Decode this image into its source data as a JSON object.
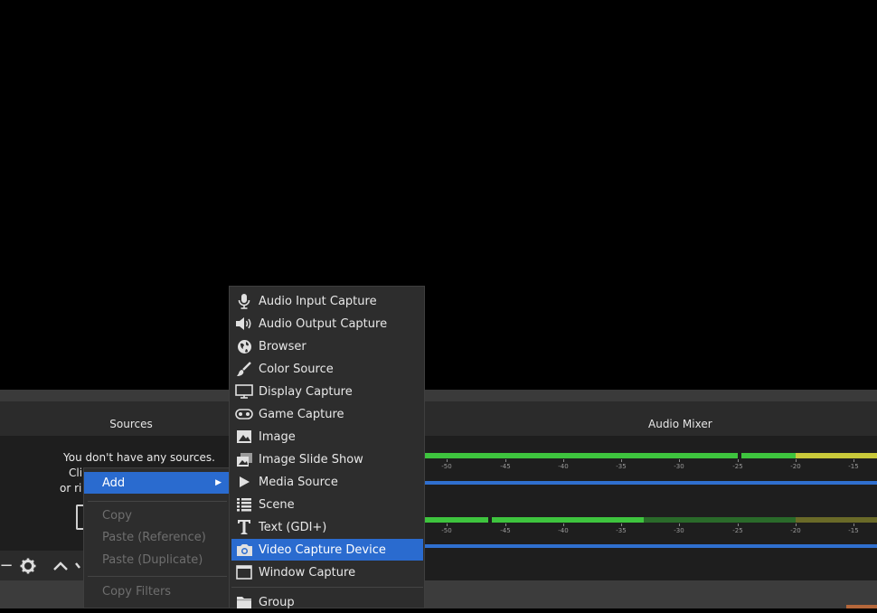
{
  "docks": {
    "sources_title": "Sources",
    "mixer_title": "Audio Mixer"
  },
  "sources_empty": {
    "line1": "You don't have any sources.",
    "line2": "Cli",
    "line3": "or ri"
  },
  "toolbar": {
    "remove": "−",
    "settings": "⚙",
    "up": "⌃",
    "down": "⌄"
  },
  "mixer": {
    "ticks": [
      "-50",
      "-45",
      "-40",
      "-35",
      "-30",
      "-25",
      "-20",
      "-15"
    ],
    "colors": {
      "green": "#3ec43e",
      "dark_green": "#2a6a2a",
      "yellow": "#c9c93a",
      "dark_yellow": "#6a6a28",
      "volume": "#2f6fcf"
    }
  },
  "context_menu": {
    "items": [
      {
        "label": "Add",
        "enabled": true,
        "highlighted": true,
        "submenu": true
      },
      {
        "label": "Copy",
        "enabled": false
      },
      {
        "label": "Paste (Reference)",
        "enabled": false
      },
      {
        "label": "Paste (Duplicate)",
        "enabled": false
      },
      {
        "label": "Copy Filters",
        "enabled": false
      }
    ]
  },
  "add_submenu": {
    "items": [
      {
        "label": "Audio Input Capture",
        "icon": "microphone-icon"
      },
      {
        "label": "Audio Output Capture",
        "icon": "speaker-icon"
      },
      {
        "label": "Browser",
        "icon": "globe-icon"
      },
      {
        "label": "Color Source",
        "icon": "paintbrush-icon"
      },
      {
        "label": "Display Capture",
        "icon": "monitor-icon"
      },
      {
        "label": "Game Capture",
        "icon": "gamepad-icon"
      },
      {
        "label": "Image",
        "icon": "image-icon"
      },
      {
        "label": "Image Slide Show",
        "icon": "slideshow-icon"
      },
      {
        "label": "Media Source",
        "icon": "play-icon"
      },
      {
        "label": "Scene",
        "icon": "list-icon"
      },
      {
        "label": "Text (GDI+)",
        "icon": "text-icon"
      },
      {
        "label": "Video Capture Device",
        "icon": "camera-icon",
        "selected": true
      },
      {
        "label": "Window Capture",
        "icon": "window-icon"
      },
      {
        "label": "Group",
        "icon": "folder-icon"
      }
    ]
  }
}
